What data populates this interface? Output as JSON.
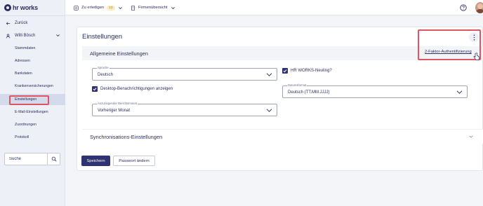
{
  "brand": {
    "logo_text": "hr works"
  },
  "sidebar": {
    "back_label": "Zurück",
    "user_label": "Willi Bösch",
    "items": [
      {
        "label": "Stammdaten",
        "active": false
      },
      {
        "label": "Adressen",
        "active": false
      },
      {
        "label": "Bankdaten",
        "active": false
      },
      {
        "label": "Krankenversicherungen",
        "active": false
      },
      {
        "label": "Einstellungen",
        "active": true
      },
      {
        "label": "E-Mail-Einstellungen",
        "active": false
      },
      {
        "label": "Zuordnungen",
        "active": false
      },
      {
        "label": "Protokoll",
        "active": false
      }
    ],
    "search_placeholder": "Suche"
  },
  "topbar": {
    "todo_label": "Zu erledigen",
    "todo_count": "13",
    "company_label": "Firmenübersicht"
  },
  "main": {
    "title": "Einstellungen",
    "general_section": "Allgemeine Einstellungen",
    "sync_section": "Synchronisations-Einstellungen",
    "language": {
      "label": "Sprache",
      "value": "Deutsch"
    },
    "desktop_notifications": {
      "label": "Desktop-Benachrichtigungen anzeigen",
      "checked": true
    },
    "month": {
      "label": "Anzuzeigender Berichtsmonat",
      "value": "Vorheriger Monat"
    },
    "newbie": {
      "label": "HR WORKS-Neuling?",
      "checked": true
    },
    "date_format": {
      "label": "Datumsformat",
      "value": "Deutsch (TT.MM.JJJJ)"
    },
    "save_label": "Speichern",
    "password_label": "Passwort ändern"
  },
  "menu": {
    "two_factor_label": "2-Faktor-Authentifizierung"
  },
  "colors": {
    "primary": "#2f3372",
    "highlight": "#e05561",
    "badge_bg": "#fbecc7"
  }
}
